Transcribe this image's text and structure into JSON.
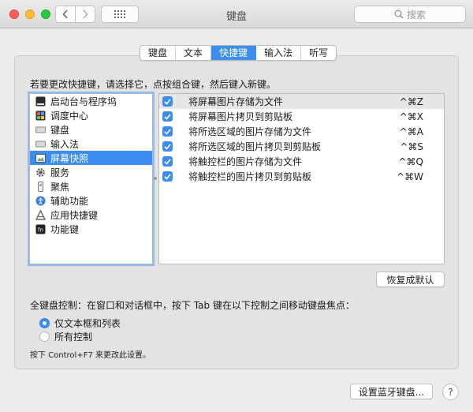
{
  "window": {
    "title": "键盘",
    "search_placeholder": "搜索"
  },
  "tabs": [
    {
      "label": "键盘"
    },
    {
      "label": "文本"
    },
    {
      "label": "快捷键"
    },
    {
      "label": "输入法"
    },
    {
      "label": "听写"
    }
  ],
  "active_tab": "快捷键",
  "instruction": "若要更改快捷键，请选择它，点按组合键，然后键入新键。",
  "categories": [
    {
      "label": "启动台与程序坞",
      "icon": "launchpad-dock-icon"
    },
    {
      "label": "调度中心",
      "icon": "mission-control-icon"
    },
    {
      "label": "键盘",
      "icon": "keyboard-icon"
    },
    {
      "label": "输入法",
      "icon": "input-method-icon"
    },
    {
      "label": "屏幕快照",
      "icon": "screenshot-icon"
    },
    {
      "label": "服务",
      "icon": "gear-icon"
    },
    {
      "label": "聚焦",
      "icon": "spotlight-icon"
    },
    {
      "label": "辅助功能",
      "icon": "accessibility-icon"
    },
    {
      "label": "应用快捷键",
      "icon": "app-shortcuts-icon"
    },
    {
      "label": "功能键",
      "icon": "fn-key-icon"
    }
  ],
  "selected_category": "屏幕快照",
  "shortcuts": [
    {
      "name": "将屏幕图片存储为文件",
      "keys": "^⌘Z",
      "checked": true
    },
    {
      "name": "将屏幕图片拷贝到剪贴板",
      "keys": "^⌘X",
      "checked": true
    },
    {
      "name": "将所选区域的图片存储为文件",
      "keys": "^⌘A",
      "checked": true
    },
    {
      "name": "将所选区域的图片拷贝到剪贴板",
      "keys": "^⌘S",
      "checked": true
    },
    {
      "name": "将触控栏的图片存储为文件",
      "keys": "^⌘Q",
      "checked": true
    },
    {
      "name": "将触控栏的图片拷贝到剪贴板",
      "keys": "^⌘W",
      "checked": true
    }
  ],
  "restore_defaults_label": "恢复成默认",
  "keyboard_control": {
    "label": "全键盘控制：在窗口和对话框中，按下 Tab 键在以下控制之间移动键盘焦点：",
    "options": [
      {
        "label": "仅文本框和列表",
        "selected": true
      },
      {
        "label": "所有控制",
        "selected": false
      }
    ],
    "hint": "按下 Control+F7 来更改此设置。"
  },
  "setup_bluetooth_label": "设置蓝牙键盘...",
  "help_label": "?",
  "colors": {
    "accent": "#3b8ef0",
    "panel": "#e3e3e3",
    "window": "#ececec"
  }
}
